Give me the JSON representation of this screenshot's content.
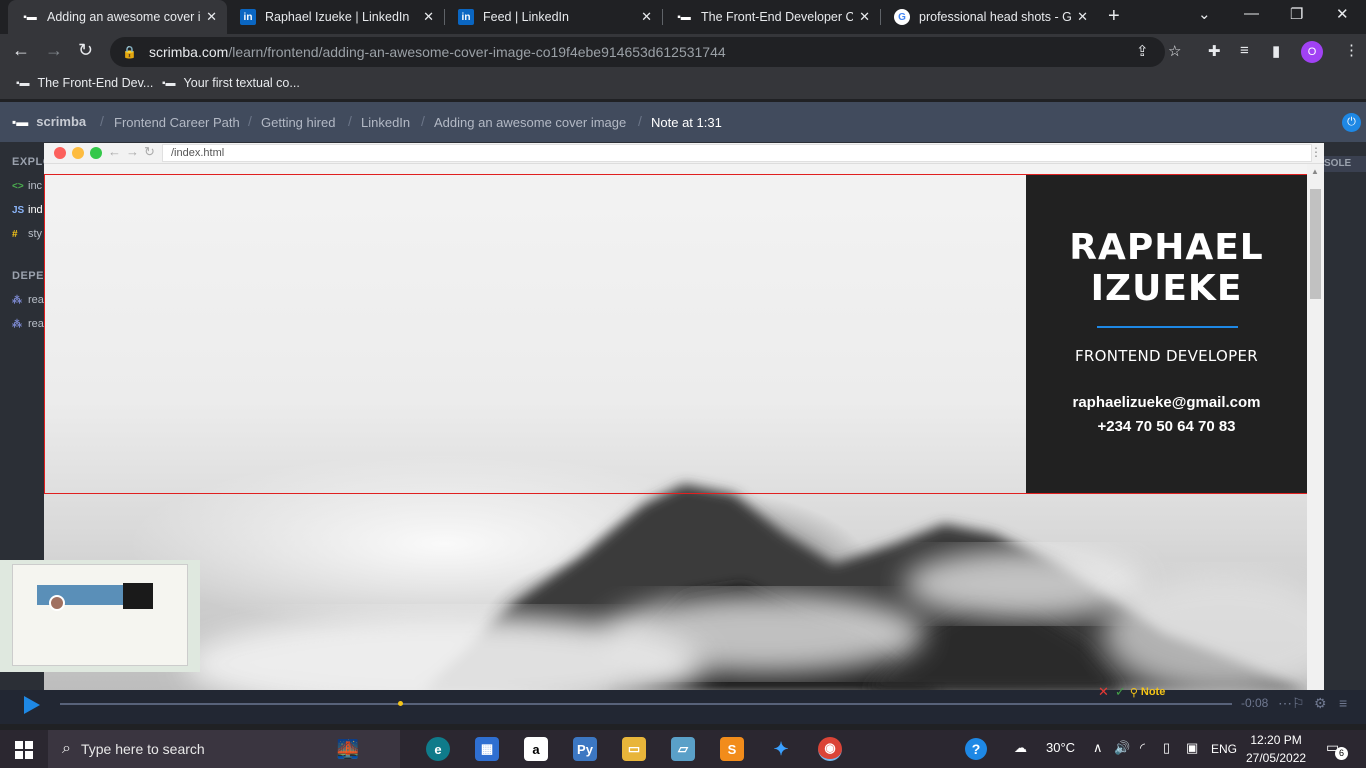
{
  "browser": {
    "tabs": [
      {
        "title": "Adding an awesome cover ima",
        "favicon": "scrimba-icon",
        "active": true
      },
      {
        "title": "Raphael Izueke | LinkedIn",
        "favicon": "linkedin-icon",
        "active": false
      },
      {
        "title": "Feed | LinkedIn",
        "favicon": "linkedin-icon",
        "active": false
      },
      {
        "title": "The Front-End Developer Ca",
        "favicon": "scrimba-icon",
        "active": false
      },
      {
        "title": "professional head shots - Go",
        "favicon": "google-icon",
        "active": false
      }
    ],
    "url_host": "scrimba.com",
    "url_path": "/learn/frontend/adding-an-awesome-cover-image-co19f4ebe914653d612531744",
    "profile_initial": "O",
    "bookmarks": [
      {
        "label": "The Front-End Dev..."
      },
      {
        "label": "Your first textual co..."
      }
    ]
  },
  "scrimba": {
    "logo_text": "scrimba",
    "breadcrumbs": [
      "Frontend Career Path",
      "Getting hired",
      "LinkedIn",
      "Adding an awesome cover image",
      "Note at 1:31"
    ]
  },
  "sidebar": {
    "explorer_heading": "EXPLO",
    "files": [
      {
        "icon": "<>",
        "name": "inc"
      },
      {
        "icon": "JS",
        "name": "ind"
      },
      {
        "icon": "#",
        "name": "sty"
      }
    ],
    "deps_heading": "DEPE",
    "deps": [
      {
        "name": "rea"
      },
      {
        "name": "rea"
      }
    ],
    "console_tab": "SOLE"
  },
  "mini_browser": {
    "url": "/index.html"
  },
  "cover": {
    "name_line1": "RAPHAEL",
    "name_line2": "IZUEKE",
    "role": "FRONTEND DEVELOPER",
    "email": "raphaelizueke@gmail.com",
    "phone": "+234 70 50 64 70 83",
    "accent_color": "#1e88e5"
  },
  "player": {
    "time_remaining": "-0:08",
    "note_label": "Note",
    "progress_fraction": 0.29
  },
  "taskbar": {
    "search_placeholder": "Type here to search",
    "weather": "30°C",
    "language": "ENG",
    "time": "12:20 PM",
    "date": "27/05/2022",
    "notification_count": "6"
  }
}
